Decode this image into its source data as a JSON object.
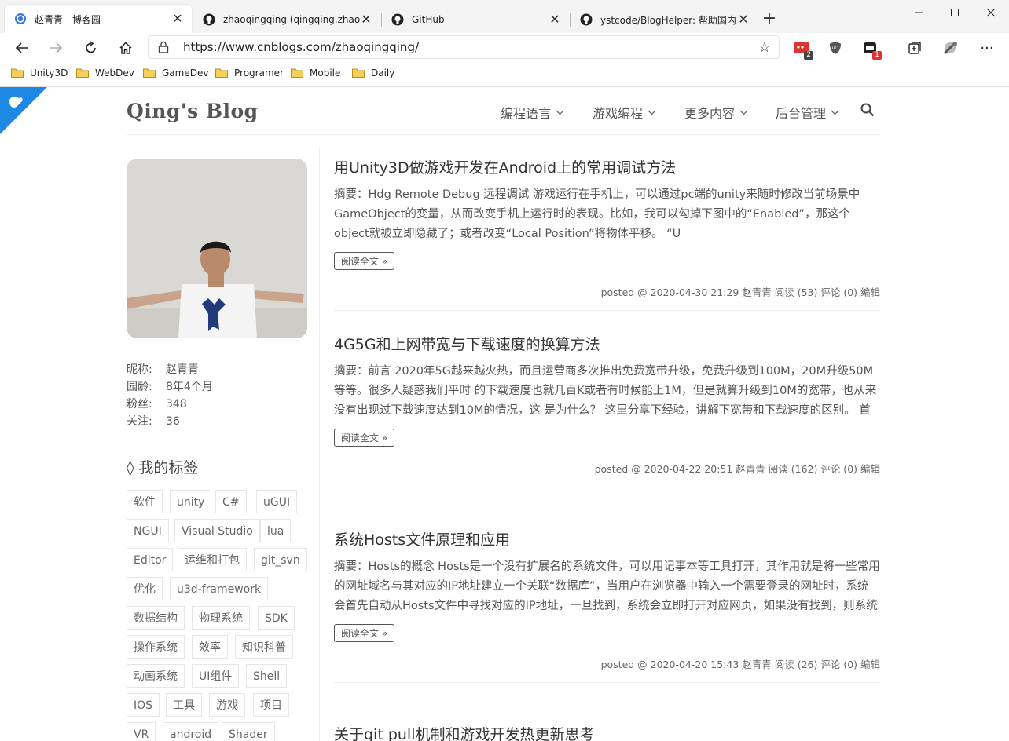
{
  "tabs": [
    {
      "title": "赵青青 - 博客园",
      "favicon": "cnblogs-icon",
      "active": true
    },
    {
      "title": "zhaoqingqing (qingqing.zhao)",
      "favicon": "github-icon",
      "active": false
    },
    {
      "title": "GitHub",
      "favicon": "github-icon",
      "active": false
    },
    {
      "title": "ystcode/BlogHelper: 帮助国内用",
      "favicon": "github-icon",
      "active": false
    }
  ],
  "address": {
    "url": "https://www.cnblogs.com/zhaoqingqing/"
  },
  "extensions": {
    "badge1": "2",
    "badge2": "1"
  },
  "bookmarks": [
    "Unity3D",
    "WebDev",
    "GameDev",
    "Programer",
    "Mobile",
    "Daily"
  ],
  "blog": {
    "title": "Qing's Blog",
    "nav": [
      "编程语言",
      "游戏编程",
      "更多内容",
      "后台管理"
    ]
  },
  "profile": {
    "rows": [
      {
        "k": "昵称:",
        "v": "赵青青"
      },
      {
        "k": "园龄:",
        "v": "8年4个月"
      },
      {
        "k": "粉丝:",
        "v": "348"
      },
      {
        "k": "关注:",
        "v": "36"
      }
    ]
  },
  "tags_heading": "◊ 我的标签",
  "tags": [
    "软件",
    "unity",
    "C#",
    "uGUI",
    "NGUI",
    "Visual Studio",
    "lua",
    "Editor",
    "运维和打包",
    "git_svn",
    "优化",
    "u3d-framework",
    "数据结构",
    "物理系统",
    "SDK",
    "操作系统",
    "效率",
    "知识科普",
    "动画系统",
    "UI组件",
    "Shell",
    "IOS",
    "工具",
    "游戏",
    "项目",
    "VR",
    "android",
    "Shader"
  ],
  "posts": [
    {
      "title": "用Unity3D做游戏开发在Android上的常用调试方法",
      "summary": "摘要：Hdg Remote Debug 远程调试 游戏运行在手机上，可以通过pc端的unity来随时修改当前场景中GameObject的变量，从而改变手机上运行时的表现。比如，我可以勾掉下图中的“Enabled”，那这个object就被立即隐藏了；或者改变“Local Position”将物体平移。 “U",
      "more": "阅读全文 »",
      "meta": "posted @ 2020-04-30 21:29 赵青青 阅读 (53) 评论 (0) 编辑"
    },
    {
      "title": "4G5G和上网带宽与下载速度的换算方法",
      "summary": "摘要：前言 2020年5G越来越火热，而且运营商多次推出免费宽带升级，免费升级到100M，20M升级50M等等。很多人疑惑我们平时 的下载速度也就几百K或者有时候能上1M，但是就算升级到10M的宽带，也从来没有出现过下载速度达到10M的情况，这 是为什么？ 这里分享下经验，讲解下宽带和下载速度的区别。 首",
      "more": "阅读全文 »",
      "meta": "posted @ 2020-04-22 20:51 赵青青 阅读 (162) 评论 (0) 编辑"
    },
    {
      "title": "系统Hosts文件原理和应用",
      "summary": "摘要：Hosts的概念 Hosts是一个没有扩展名的系统文件，可以用记事本等工具打开，其作用就是将一些常用的网址域名与其对应的IP地址建立一个关联“数据库”，当用户在浏览器中输入一个需要登录的网址时，系统会首先自动从Hosts文件中寻找对应的IP地址，一旦找到，系统会立即打开对应网页，如果没有找到，则系统",
      "more": "阅读全文 »",
      "meta": "posted @ 2020-04-20 15:43 赵青青 阅读 (26) 评论 (0) 编辑"
    },
    {
      "title": "关于git pull机制和游戏开发热更新思考",
      "summary": "",
      "more": "",
      "meta": ""
    }
  ]
}
